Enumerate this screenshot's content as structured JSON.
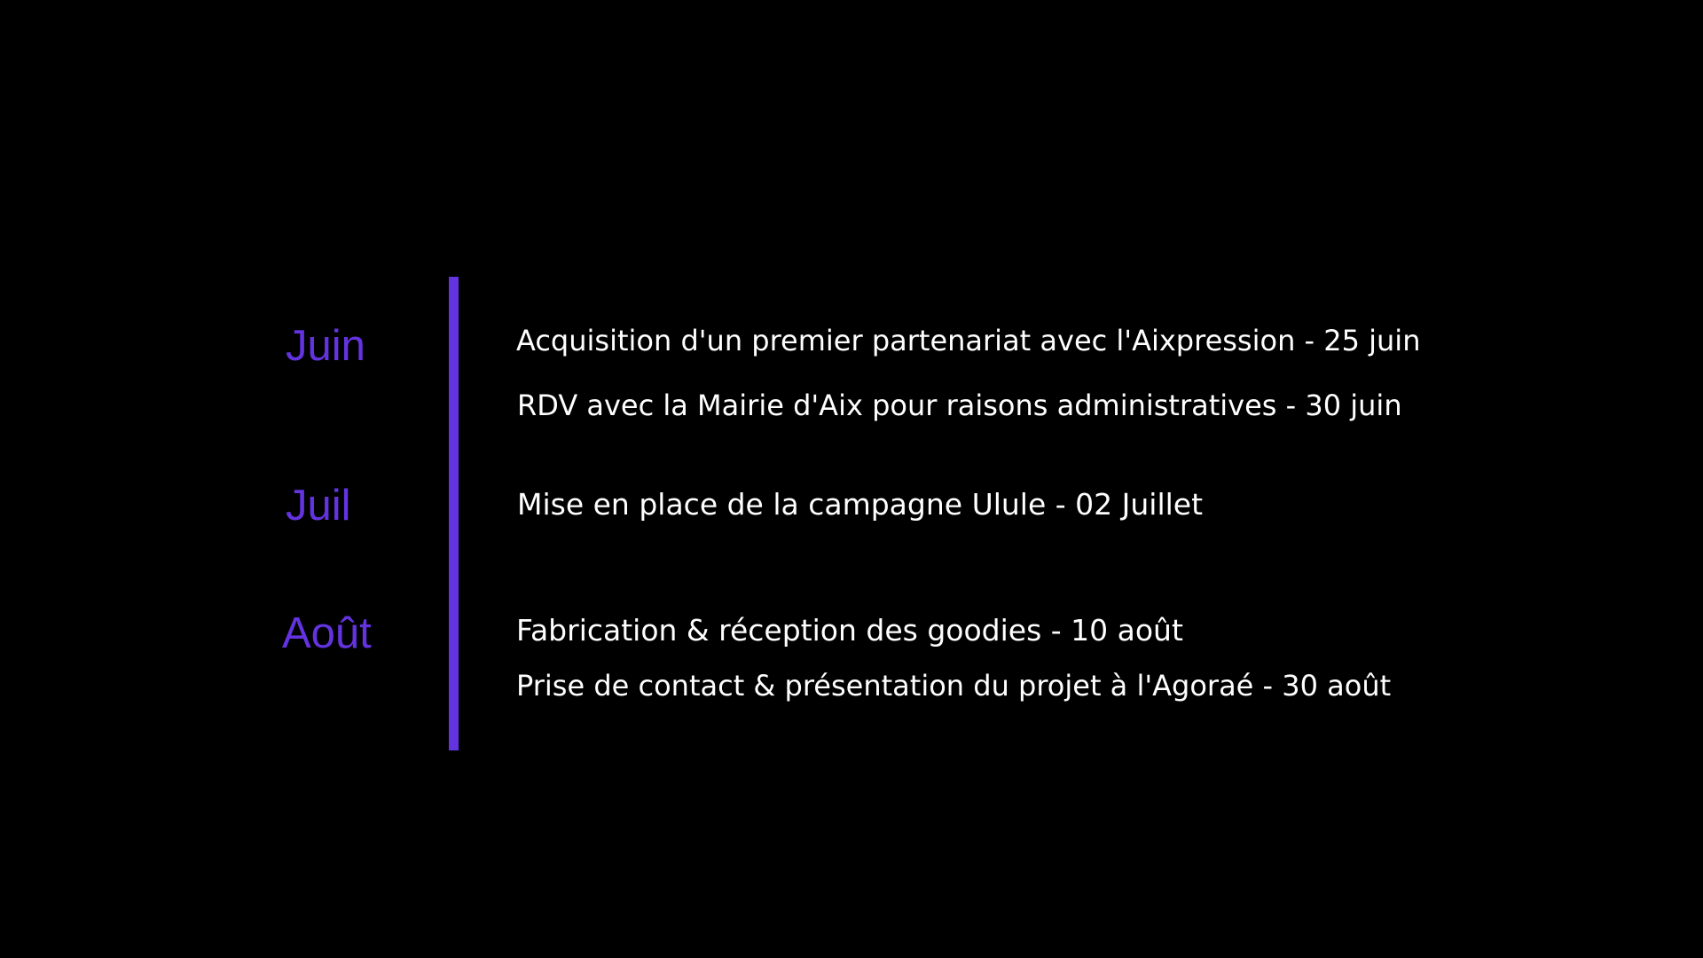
{
  "colors": {
    "background": "#000000",
    "accent": "#6433e0",
    "text": "#ffffff"
  },
  "timeline": {
    "months": [
      {
        "label": "Juin",
        "events": [
          "Acquisition d'un premier partenariat avec l'Aixpression - 25 juin",
          "RDV avec la Mairie d'Aix pour raisons administratives - 30 juin"
        ]
      },
      {
        "label": "Juil",
        "events": [
          "Mise en place de la campagne Ulule - 02 Juillet"
        ]
      },
      {
        "label": "Août",
        "events": [
          "Fabrication & réception des goodies - 10 août",
          "Prise de contact & présentation du projet à l'Agoraé - 30 août"
        ]
      }
    ]
  }
}
